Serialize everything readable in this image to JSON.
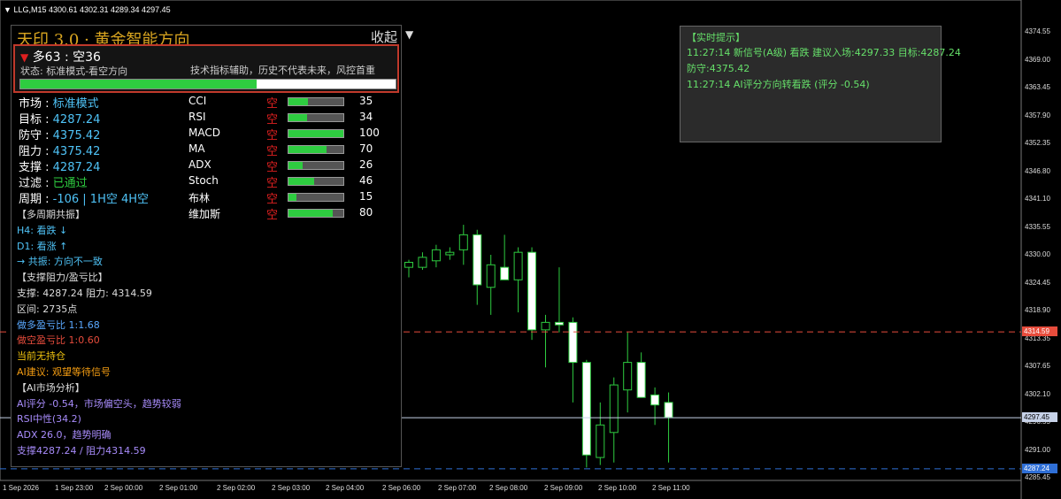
{
  "colors": {
    "up": "#2ecc40",
    "down": "#e02020",
    "cyan": "#4fc3f7",
    "gold": "#d9a520"
  },
  "header": {
    "symbol_line": "LLG,M15  4300.61 4302.31 4289.34 4297.45"
  },
  "panel": {
    "title": "天印 3.0 · 黄金智能方向",
    "collapse_label": "收起",
    "signal": {
      "direction_text": "多63 : 空36",
      "status": "状态: 标准模式-看空方向",
      "disclaimer": "技术指标辅助，历史不代表未来，风控首重",
      "strength": 0.63
    },
    "info": [
      {
        "label": "市场 : ",
        "value": "标准模式"
      },
      {
        "label": "目标 : ",
        "value": "4287.24"
      },
      {
        "label": "防守 : ",
        "value": "4375.42"
      },
      {
        "label": "阻力 : ",
        "value": "4375.42"
      },
      {
        "label": "支撑 : ",
        "value": "4287.24"
      },
      {
        "label": "过滤 : ",
        "value": "已通过"
      },
      {
        "label": "周期 : ",
        "value": "-106 | 1H空 4H空"
      }
    ],
    "indicators": [
      {
        "name": "CCI",
        "dir": "空",
        "value": "35",
        "pct": 0.35
      },
      {
        "name": "RSI",
        "dir": "空",
        "value": "34",
        "pct": 0.34
      },
      {
        "name": "MACD",
        "dir": "空",
        "value": "100",
        "pct": 1.0
      },
      {
        "name": "MA",
        "dir": "空",
        "value": "70",
        "pct": 0.7
      },
      {
        "name": "ADX",
        "dir": "空",
        "value": "26",
        "pct": 0.26
      },
      {
        "name": "Stoch",
        "dir": "空",
        "value": "46",
        "pct": 0.46
      },
      {
        "name": "布林",
        "dir": "空",
        "value": "15",
        "pct": 0.15
      },
      {
        "name": "维加斯",
        "dir": "空",
        "value": "80",
        "pct": 0.8
      }
    ],
    "sections": [
      {
        "text": "【多周期共振】",
        "cls": "c-white"
      },
      {
        "text": "H4: 看跌 ↓",
        "cls": "c-cyan"
      },
      {
        "text": "D1: 看涨 ↑",
        "cls": "c-cyan"
      },
      {
        "text": "→ 共振: 方向不一致",
        "cls": "c-cyan"
      },
      {
        "text": "【支撑阻力/盈亏比】",
        "cls": "c-white"
      },
      {
        "text": "支撑: 4287.24  阻力: 4314.59",
        "cls": "c-white"
      },
      {
        "text": "区间: 2735点",
        "cls": "c-white"
      },
      {
        "text": "做多盈亏比 1:1.68",
        "cls": "c-blue"
      },
      {
        "text": "做空盈亏比 1:0.60",
        "cls": "c-red"
      },
      {
        "text": "当前无持仓",
        "cls": "c-gold"
      },
      {
        "text": "AI建议: 观望等待信号",
        "cls": "c-orange"
      },
      {
        "text": "【AI市场分析】",
        "cls": "c-white"
      },
      {
        "text": "AI评分 -0.54，市场偏空头，趋势较弱",
        "cls": "c-purple"
      },
      {
        "text": "RSI中性(34.2)",
        "cls": "c-purple"
      },
      {
        "text": "ADX 26.0，趋势明确",
        "cls": "c-purple"
      },
      {
        "text": "支撑4287.24 / 阻力4314.59",
        "cls": "c-purple"
      }
    ]
  },
  "realtime": {
    "title": "【实时提示】",
    "lines": [
      "11:27:14 新信号(A级) 看跌 建议入场:4297.33 目标:4287.24",
      "防守:4375.42",
      "11:27:14 AI评分方向转看跌 (评分 -0.54)"
    ]
  },
  "axis": {
    "price_labels": [
      "4374.55",
      "4369.00",
      "4363.45",
      "4357.90",
      "4352.35",
      "4346.80",
      "4341.10",
      "4335.55",
      "4330.00",
      "4324.45",
      "4318.90",
      "4313.35",
      "4307.65",
      "4302.10",
      "4296.55",
      "4291.00",
      "4285.45"
    ],
    "time_labels": [
      "1 Sep 2026",
      "1 Sep 23:00",
      "2 Sep 00:00",
      "2 Sep 01:00",
      "2 Sep 02:00",
      "2 Sep 03:00",
      "2 Sep 04:00",
      "2 Sep 06:00",
      "2 Sep 07:00",
      "2 Sep 08:00",
      "2 Sep 09:00",
      "2 Sep 10:00",
      "2 Sep 11:00"
    ]
  },
  "levels": {
    "resistance": {
      "price": 4314.59,
      "label": "4314.59",
      "color": "#e74c3c"
    },
    "current": {
      "price": 4297.45,
      "label": "4297.45",
      "color": "#c7d2e8"
    },
    "support": {
      "price": 4287.24,
      "label": "4287.24",
      "color": "#2f6fd6"
    }
  },
  "chart_data": {
    "type": "candlestick",
    "y_range": [
      4285.45,
      4374.55
    ],
    "candles": [
      {
        "o": 4327.5,
        "h": 4329.0,
        "l": 4325.5,
        "c": 4328.5
      },
      {
        "o": 4327.5,
        "h": 4330.5,
        "l": 4327.0,
        "c": 4329.5
      },
      {
        "o": 4328.8,
        "h": 4332.0,
        "l": 4327.5,
        "c": 4331.0
      },
      {
        "o": 4330.0,
        "h": 4331.5,
        "l": 4329.0,
        "c": 4330.5
      },
      {
        "o": 4331.0,
        "h": 4336.0,
        "l": 4328.0,
        "c": 4334.0
      },
      {
        "o": 4334.0,
        "h": 4335.0,
        "l": 4320.0,
        "c": 4324.0
      },
      {
        "o": 4323.5,
        "h": 4330.0,
        "l": 4318.0,
        "c": 4328.0
      },
      {
        "o": 4327.5,
        "h": 4334.0,
        "l": 4325.5,
        "c": 4325.0
      },
      {
        "o": 4325.0,
        "h": 4331.5,
        "l": 4318.5,
        "c": 4330.5
      },
      {
        "o": 4330.5,
        "h": 4331.5,
        "l": 4313.0,
        "c": 4315.0
      },
      {
        "o": 4315.0,
        "h": 4318.0,
        "l": 4307.5,
        "c": 4316.5
      },
      {
        "o": 4316.5,
        "h": 4327.5,
        "l": 4314.5,
        "c": 4316.0
      },
      {
        "o": 4316.5,
        "h": 4317.5,
        "l": 4300.5,
        "c": 4308.5
      },
      {
        "o": 4308.5,
        "h": 4309.0,
        "l": 4287.5,
        "c": 4290.0
      },
      {
        "o": 4289.5,
        "h": 4300.5,
        "l": 4288.0,
        "c": 4296.0
      },
      {
        "o": 4294.5,
        "h": 4305.5,
        "l": 4288.5,
        "c": 4304.0
      },
      {
        "o": 4303.0,
        "h": 4314.5,
        "l": 4298.5,
        "c": 4308.5
      },
      {
        "o": 4308.5,
        "h": 4310.5,
        "l": 4301.5,
        "c": 4301.5
      },
      {
        "o": 4302.0,
        "h": 4303.5,
        "l": 4296.0,
        "c": 4300.0
      },
      {
        "o": 4300.5,
        "h": 4302.5,
        "l": 4288.5,
        "c": 4297.5
      }
    ]
  }
}
